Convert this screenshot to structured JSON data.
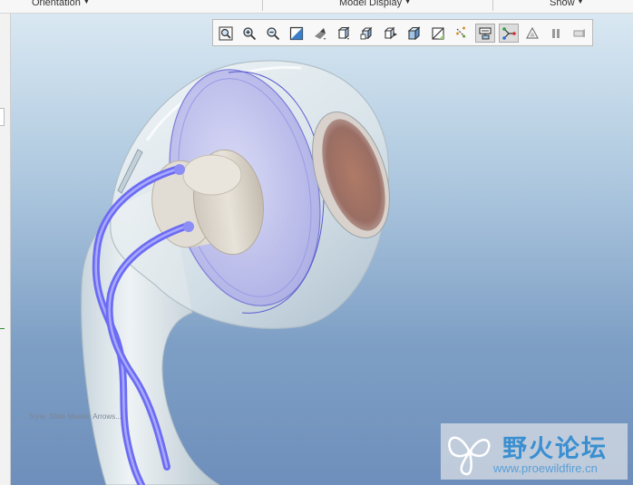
{
  "ribbon": {
    "groups": [
      {
        "label": "Orientation"
      },
      {
        "label": "Model Display"
      },
      {
        "label": "Show"
      }
    ]
  },
  "toolbar": {
    "buttons": [
      {
        "icon": "refit-icon"
      },
      {
        "icon": "zoom-in-icon"
      },
      {
        "icon": "zoom-out-icon"
      },
      {
        "icon": "repaint-icon"
      },
      {
        "icon": "perspective-view-icon"
      },
      {
        "icon": "saved-orientations-icon"
      },
      {
        "icon": "view-manager-icon"
      },
      {
        "icon": "display-style-icon"
      },
      {
        "icon": "section-icon"
      },
      {
        "icon": "datum-planes-icon"
      },
      {
        "icon": "datum-axes-icon"
      },
      {
        "icon": "annotation-display-icon",
        "active": true
      },
      {
        "icon": "spin-center-icon",
        "active": true
      },
      {
        "icon": "appearance-icon"
      },
      {
        "icon": "pause-icon"
      },
      {
        "icon": "animation-icon"
      }
    ]
  },
  "viewport": {
    "status_text": "Style: Slide Master, Arrows..."
  },
  "watermark": {
    "text": "野火论坛",
    "url": "www.proewildfire.cn"
  }
}
